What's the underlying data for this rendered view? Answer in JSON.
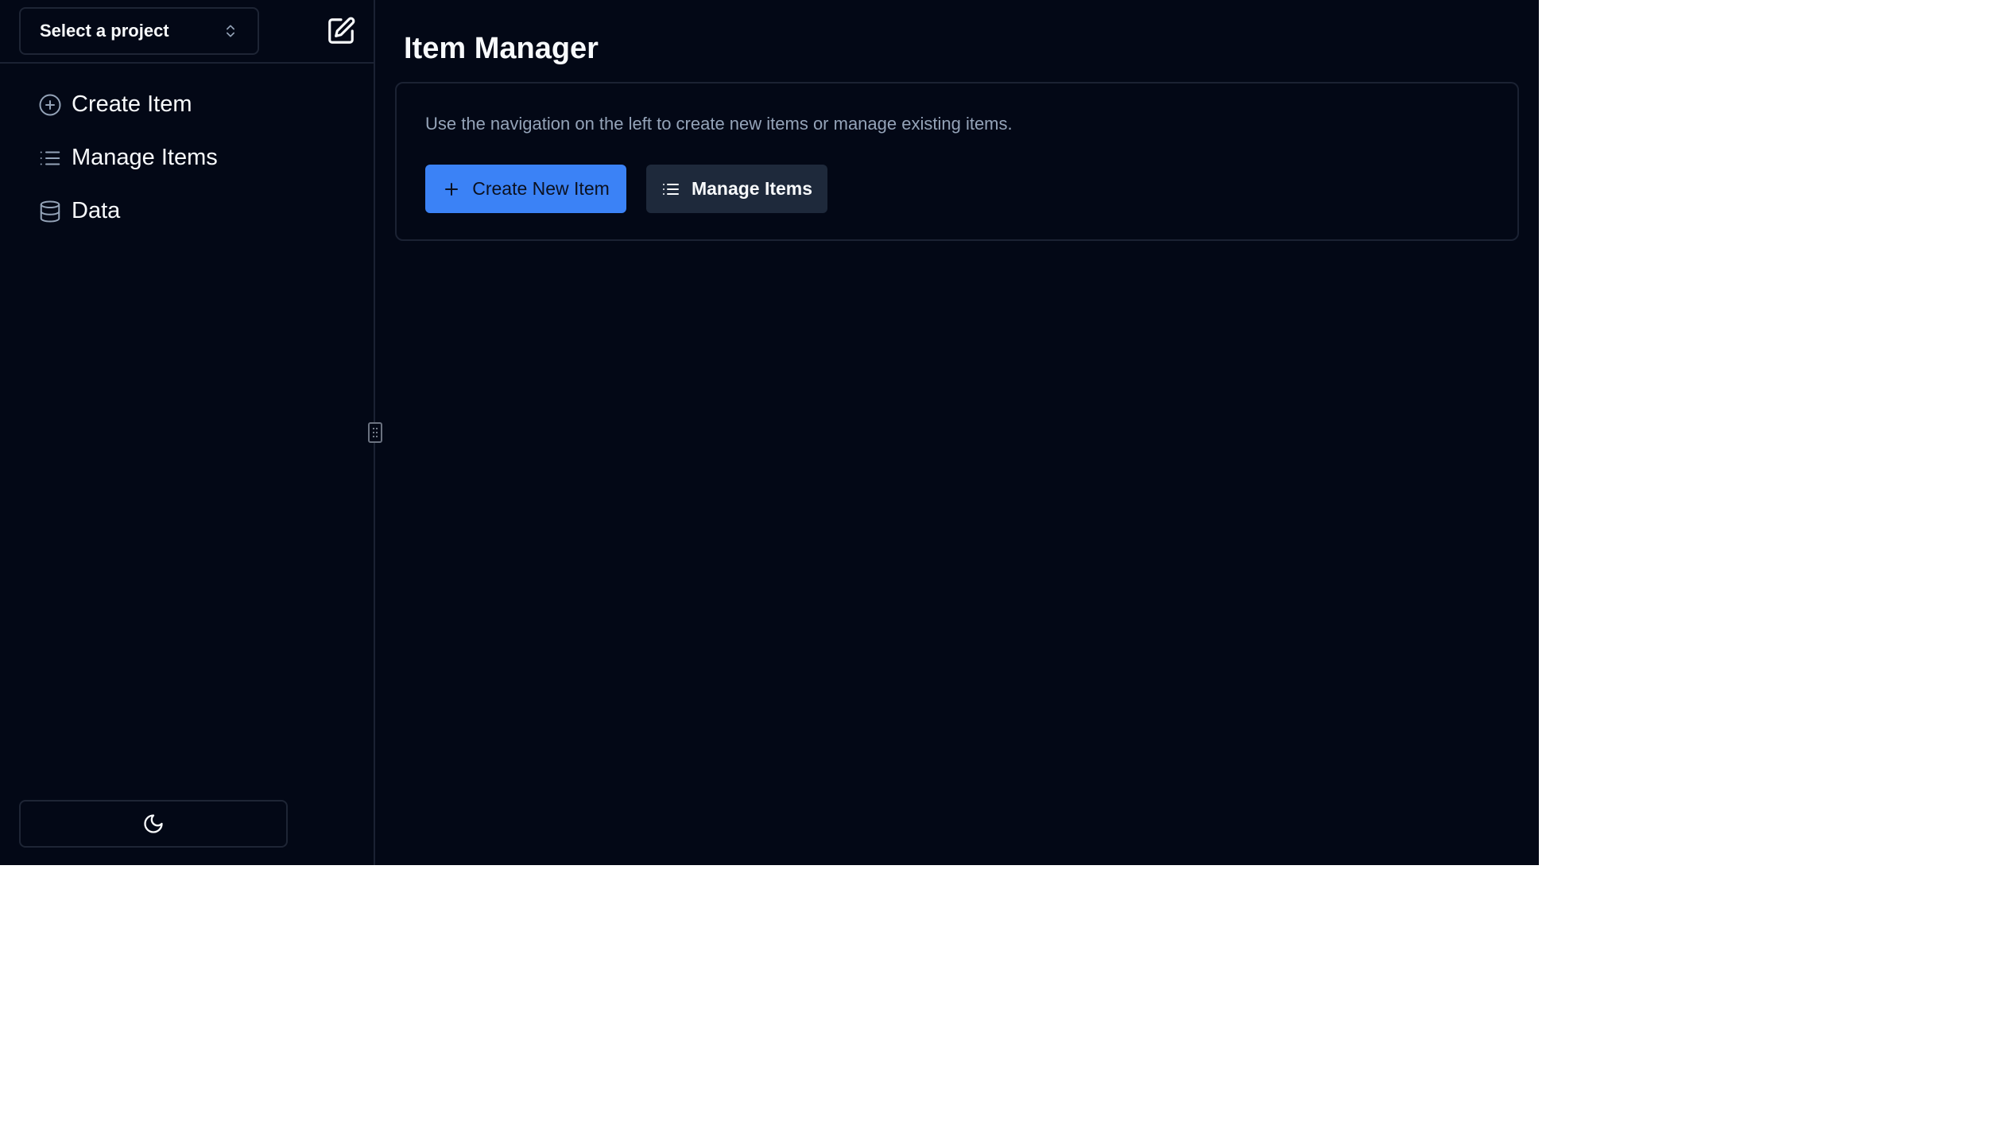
{
  "sidebar": {
    "project_select": {
      "label": "Select a project",
      "icon": "chevrons-up-down-icon"
    },
    "edit_icon": "square-pen-icon",
    "items": [
      {
        "label": "Create Item",
        "icon": "circle-plus-icon"
      },
      {
        "label": "Manage Items",
        "icon": "list-icon"
      },
      {
        "label": "Data",
        "icon": "database-icon"
      }
    ],
    "theme_toggle_icon": "moon-icon"
  },
  "main": {
    "title": "Item Manager",
    "card": {
      "description": "Use the navigation on the left to create new items or manage existing items.",
      "primary_button": {
        "label": "Create New Item",
        "icon": "plus-icon"
      },
      "secondary_button": {
        "label": "Manage Items",
        "icon": "list-icon"
      }
    }
  },
  "colors": {
    "background": "#030816",
    "border": "#1b2233",
    "accent": "#3b82f6",
    "secondary_button": "#1e293b",
    "muted_text": "#94a3b8"
  }
}
